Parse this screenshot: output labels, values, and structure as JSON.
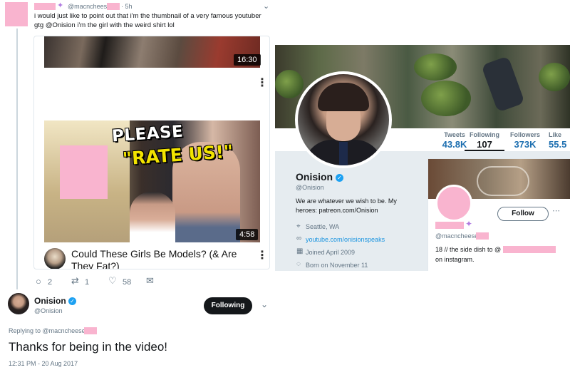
{
  "original_tweet": {
    "handle": "@macncheese",
    "time": "· 5h",
    "text_line1": "i would just like to point out that i'm the thumbnail of a very famous youtuber",
    "text_line2": "gtg @Onision i'm the girl with the weird shirt lol",
    "sparkle_icon": "sparkles-icon",
    "chevron_icon": "chevron-down-icon",
    "actions": {
      "reply_count": "2",
      "retweet_count": "1",
      "like_count": "58"
    }
  },
  "video_screenshot": {
    "top_duration": "16:30",
    "main_thumbnail_text_1": "PLEASE",
    "main_thumbnail_text_2": "\"RATE US!\"",
    "main_duration": "4:58",
    "video_title": "Could These Girls Be Models? (& Are They Fat?)"
  },
  "profile_screenshot": {
    "stats": [
      {
        "label": "Tweets",
        "value": "43.8K"
      },
      {
        "label": "Following",
        "value": "107"
      },
      {
        "label": "Followers",
        "value": "373K"
      },
      {
        "label": "Like",
        "value": "55.5"
      }
    ],
    "name": "Onision",
    "handle": "@Onision",
    "bio": "We are whatever we wish to be. My heroes: patreon.com/Onision",
    "location": "Seattle, WA",
    "website": "youtube.com/onisionspeaks",
    "joined": "Joined April 2009",
    "born": "Born on November 11",
    "suggestion": {
      "follow_label": "Follow",
      "handle": "@macncheese",
      "bio_prefix": "18 // the side dish to @",
      "bio_suffix": "on instagram."
    }
  },
  "reply_tweet": {
    "name": "Onision",
    "handle": "@Onision",
    "following_label": "Following",
    "replying_to": "Replying to @macncheese",
    "text": "Thanks for being in the video!",
    "timestamp": "12:31 PM - 20 Aug 2017"
  },
  "colors": {
    "accent": "#1da1f2",
    "link": "#1b95e0",
    "redaction": "#f9b4cf",
    "muted": "#657786"
  }
}
